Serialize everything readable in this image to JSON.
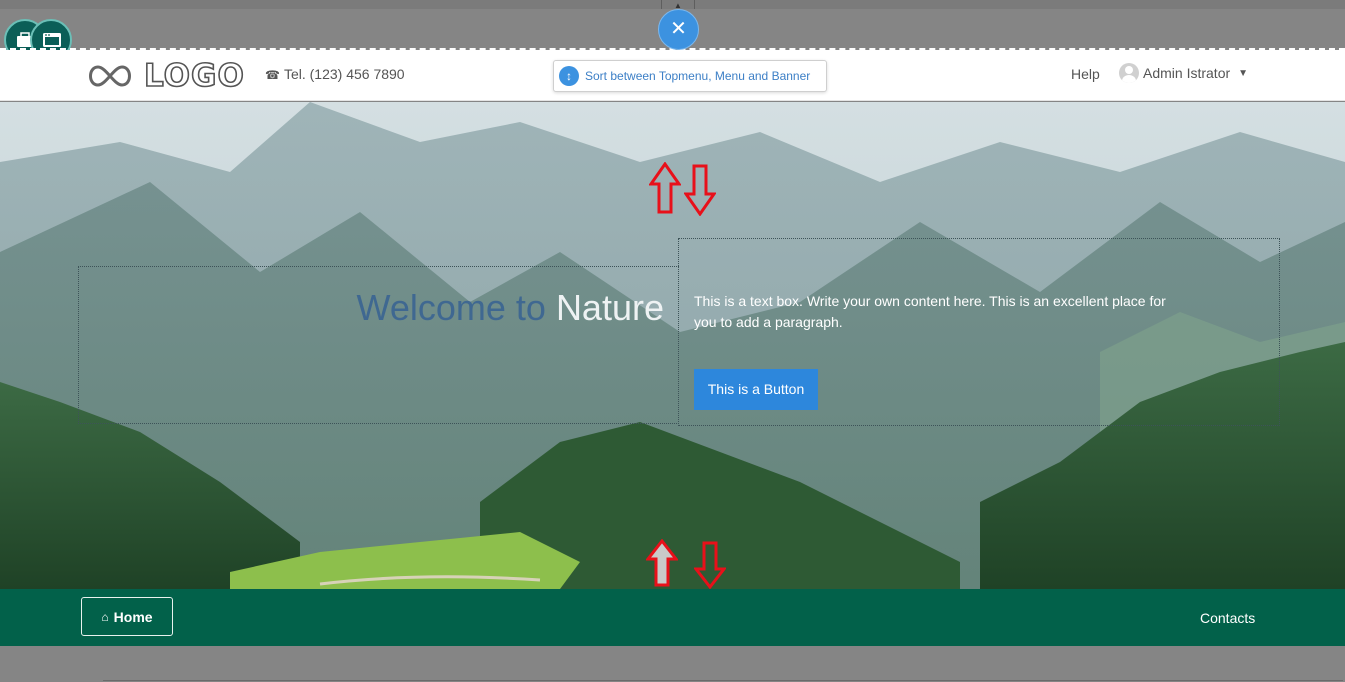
{
  "overlay": {
    "close_glyph": "✕"
  },
  "header": {
    "logo_text": "LOGO",
    "phone": "Tel. (123) 456 7890",
    "sort_label": "Sort between Topmenu, Menu and Banner",
    "help": "Help",
    "user_name": "Admin Istrator"
  },
  "banner": {
    "welcome_dark": "Welcome to",
    "welcome_light": "Nature",
    "paragraph": "This is a text box. Write your own content here. This is an excellent place for you to add a paragraph.",
    "button_label": "This is a Button"
  },
  "menu": {
    "home_label": "Home",
    "contacts_label": "Contacts"
  },
  "colors": {
    "accent_blue": "#3c92e0",
    "menu_green": "#02614a",
    "button_blue": "#2d87dc",
    "arrow_red": "#e8101a"
  }
}
